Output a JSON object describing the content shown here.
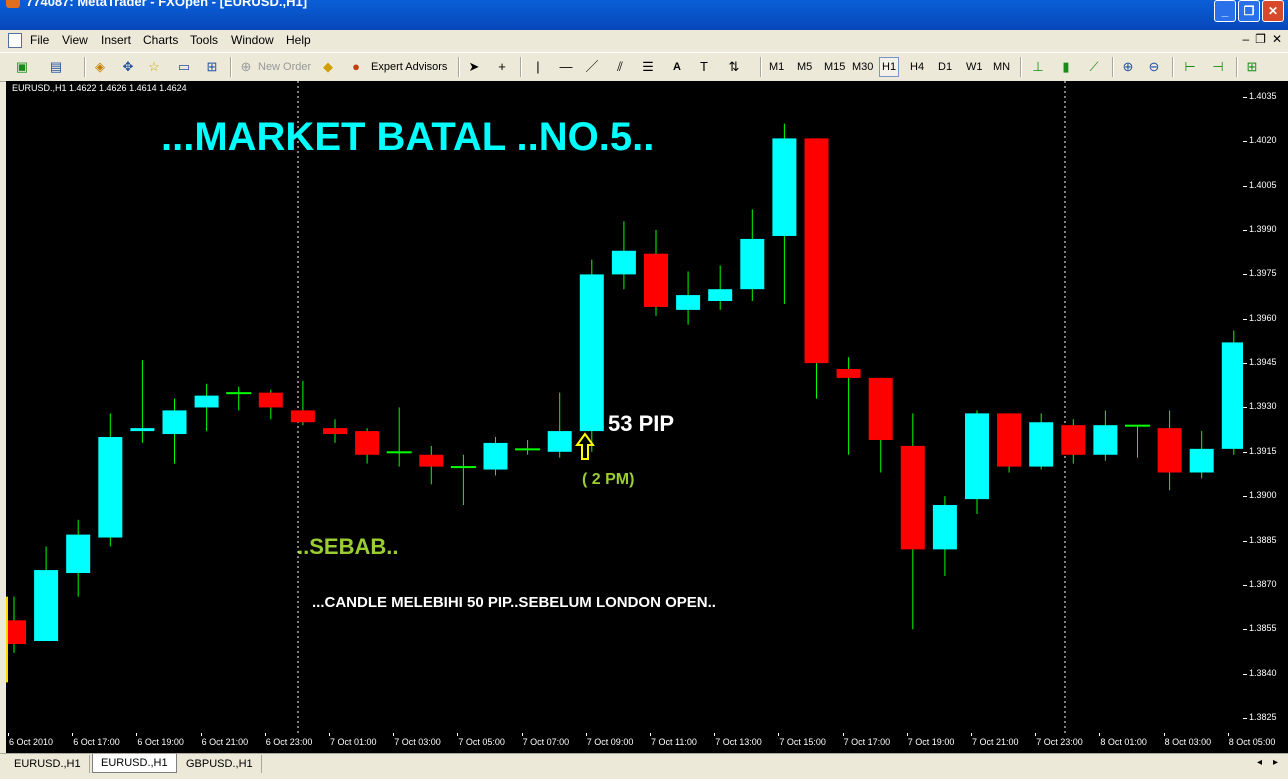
{
  "window": {
    "title": "774087: MetaTrader - FXOpen - [EURUSD.,H1]"
  },
  "menu": [
    "File",
    "View",
    "Insert",
    "Charts",
    "Tools",
    "Window",
    "Help"
  ],
  "toolbar": {
    "new_order": "New Order",
    "expert_advisors": "Expert Advisors",
    "timeframes": [
      "M1",
      "M5",
      "M15",
      "M30",
      "H1",
      "H4",
      "D1",
      "W1",
      "MN"
    ],
    "selected_timeframe": "H1",
    "text_tool": "A"
  },
  "chart": {
    "info": "EURUSD.,H1  1.4622 1.4626 1.4614 1.4624",
    "bull_color": "#00ffff",
    "bear_color": "#ff0000",
    "wick_color": "#00ff00"
  },
  "annotations": {
    "headline": "...MARKET BATAL ..NO.5..",
    "pips": "53 PIP",
    "time": "( 2 PM)",
    "reason_title": "..SEBAB..",
    "reason_text": "...CANDLE MELEBIHI 50 PIP..SEBELUM LONDON OPEN.."
  },
  "tabs": [
    "EURUSD.,H1",
    "EURUSD.,H1",
    "GBPUSD.,H1"
  ],
  "active_tab": 1,
  "chart_data": {
    "type": "candlestick",
    "price_axis_labels": [
      "1.4035",
      "1.4020",
      "1.4005",
      "1.3990",
      "1.3975",
      "1.3960",
      "1.3945",
      "1.3930",
      "1.3915",
      "1.3900",
      "1.3885",
      "1.3870",
      "1.3855",
      "1.3840",
      "1.3825"
    ],
    "time_axis_labels": [
      "6 Oct 2010",
      "6 Oct 17:00",
      "6 Oct 19:00",
      "6 Oct 21:00",
      "6 Oct 23:00",
      "7 Oct 01:00",
      "7 Oct 03:00",
      "7 Oct 05:00",
      "7 Oct 07:00",
      "7 Oct 09:00",
      "7 Oct 11:00",
      "7 Oct 13:00",
      "7 Oct 15:00",
      "7 Oct 17:00",
      "7 Oct 19:00",
      "7 Oct 21:00",
      "7 Oct 23:00",
      "8 Oct 01:00",
      "8 Oct 03:00",
      "8 Oct 05:00"
    ],
    "ylim": [
      1.382,
      1.404
    ],
    "candles": [
      {
        "o": 1.3858,
        "h": 1.3866,
        "l": 1.3847,
        "c": 1.385
      },
      {
        "o": 1.3851,
        "h": 1.3883,
        "l": 1.3851,
        "c": 1.3875
      },
      {
        "o": 1.3874,
        "h": 1.3892,
        "l": 1.3866,
        "c": 1.3887
      },
      {
        "o": 1.3886,
        "h": 1.3928,
        "l": 1.3883,
        "c": 1.392
      },
      {
        "o": 1.3922,
        "h": 1.3946,
        "l": 1.3918,
        "c": 1.3923
      },
      {
        "o": 1.3921,
        "h": 1.3933,
        "l": 1.3911,
        "c": 1.3929
      },
      {
        "o": 1.393,
        "h": 1.3938,
        "l": 1.3922,
        "c": 1.3934
      },
      {
        "o": 1.3935,
        "h": 1.3937,
        "l": 1.3929,
        "c": 1.3935
      },
      {
        "o": 1.3935,
        "h": 1.3936,
        "l": 1.3926,
        "c": 1.393
      },
      {
        "o": 1.3929,
        "h": 1.3939,
        "l": 1.3924,
        "c": 1.3925
      },
      {
        "o": 1.3923,
        "h": 1.3926,
        "l": 1.3918,
        "c": 1.3921
      },
      {
        "o": 1.3922,
        "h": 1.3923,
        "l": 1.3911,
        "c": 1.3914
      },
      {
        "o": 1.3915,
        "h": 1.393,
        "l": 1.391,
        "c": 1.3915
      },
      {
        "o": 1.3914,
        "h": 1.3917,
        "l": 1.3904,
        "c": 1.391
      },
      {
        "o": 1.391,
        "h": 1.3914,
        "l": 1.3897,
        "c": 1.391
      },
      {
        "o": 1.3909,
        "h": 1.392,
        "l": 1.3907,
        "c": 1.3918
      },
      {
        "o": 1.3916,
        "h": 1.3919,
        "l": 1.3914,
        "c": 1.3916
      },
      {
        "o": 1.3915,
        "h": 1.3935,
        "l": 1.3913,
        "c": 1.3922
      },
      {
        "o": 1.3922,
        "h": 1.398,
        "l": 1.3915,
        "c": 1.3975
      },
      {
        "o": 1.3975,
        "h": 1.3993,
        "l": 1.397,
        "c": 1.3983
      },
      {
        "o": 1.3982,
        "h": 1.399,
        "l": 1.3961,
        "c": 1.3964
      },
      {
        "o": 1.3963,
        "h": 1.3976,
        "l": 1.3958,
        "c": 1.3968
      },
      {
        "o": 1.3966,
        "h": 1.3978,
        "l": 1.3963,
        "c": 1.397
      },
      {
        "o": 1.397,
        "h": 1.3997,
        "l": 1.3966,
        "c": 1.3987
      },
      {
        "o": 1.3988,
        "h": 1.4026,
        "l": 1.3965,
        "c": 1.4021
      },
      {
        "o": 1.4021,
        "h": 1.4021,
        "l": 1.3933,
        "c": 1.3945
      },
      {
        "o": 1.3943,
        "h": 1.3947,
        "l": 1.3914,
        "c": 1.394
      },
      {
        "o": 1.394,
        "h": 1.394,
        "l": 1.3908,
        "c": 1.3919
      },
      {
        "o": 1.3917,
        "h": 1.3928,
        "l": 1.3855,
        "c": 1.3882
      },
      {
        "o": 1.3882,
        "h": 1.39,
        "l": 1.3873,
        "c": 1.3897
      },
      {
        "o": 1.3899,
        "h": 1.3929,
        "l": 1.3894,
        "c": 1.3928
      },
      {
        "o": 1.3928,
        "h": 1.3928,
        "l": 1.3908,
        "c": 1.391
      },
      {
        "o": 1.391,
        "h": 1.3928,
        "l": 1.3909,
        "c": 1.3925
      },
      {
        "o": 1.3924,
        "h": 1.3926,
        "l": 1.3911,
        "c": 1.3914
      },
      {
        "o": 1.3914,
        "h": 1.3929,
        "l": 1.3912,
        "c": 1.3924
      },
      {
        "o": 1.3924,
        "h": 1.3924,
        "l": 1.3913,
        "c": 1.3924
      },
      {
        "o": 1.3923,
        "h": 1.3929,
        "l": 1.3902,
        "c": 1.3908
      },
      {
        "o": 1.3908,
        "h": 1.3922,
        "l": 1.3906,
        "c": 1.3916
      },
      {
        "o": 1.3916,
        "h": 1.3956,
        "l": 1.3914,
        "c": 1.3952
      }
    ]
  }
}
